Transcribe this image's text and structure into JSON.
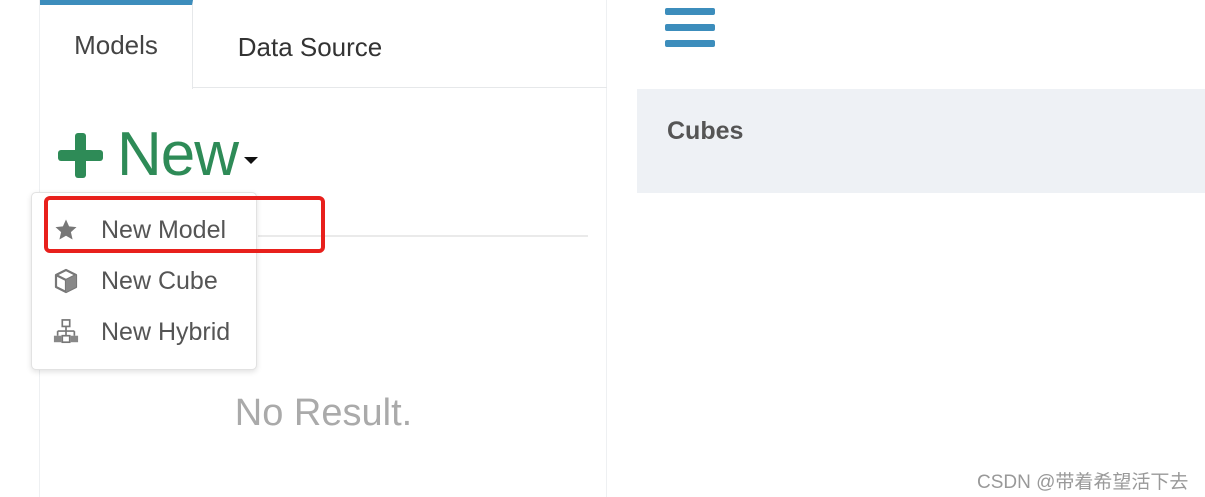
{
  "tabs": [
    {
      "label": "Models",
      "active": true
    },
    {
      "label": "Data Source",
      "active": false
    }
  ],
  "new_button": {
    "label": "New"
  },
  "dropdown": {
    "items": [
      {
        "label": "New Model",
        "icon": "star-icon"
      },
      {
        "label": "New Cube",
        "icon": "cube-icon"
      },
      {
        "label": "New Hybrid",
        "icon": "hierarchy-icon"
      }
    ]
  },
  "empty_state": "No Result.",
  "right_panel": {
    "title": "Cubes"
  },
  "watermark": "CSDN @带着希望活下去",
  "colors": {
    "accent": "#3c8dbc",
    "new_green": "#2e8b57",
    "highlight_red": "#e8201c",
    "panel_bg": "#eef1f5"
  }
}
